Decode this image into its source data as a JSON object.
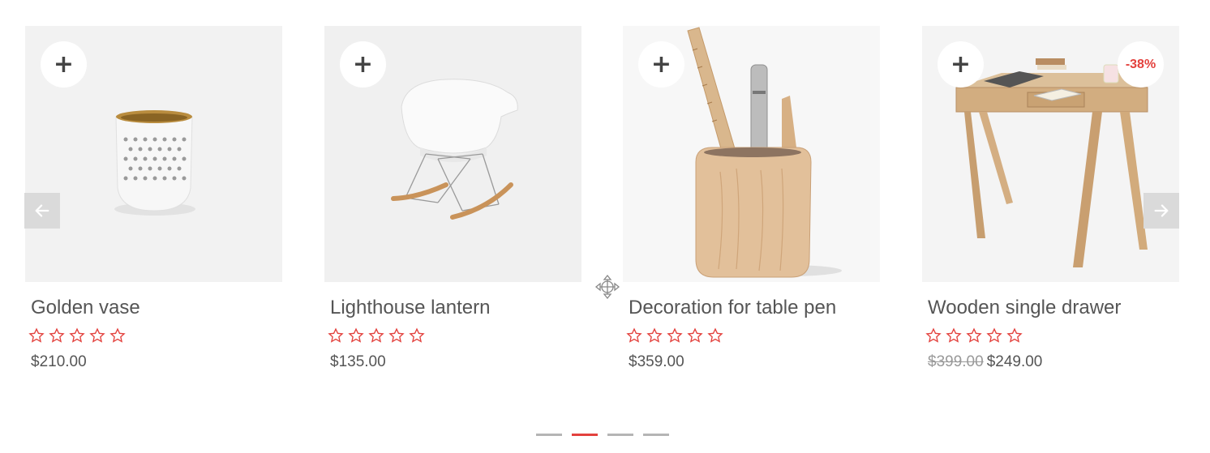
{
  "accent_color": "#e3413d",
  "products": [
    {
      "title": "Golden vase",
      "price": "$210.00",
      "old_price": "",
      "badge": "",
      "rating_stars": 5,
      "add_icon": "+"
    },
    {
      "title": "Lighthouse lantern",
      "price": "$135.00",
      "old_price": "",
      "badge": "",
      "rating_stars": 5,
      "add_icon": "+"
    },
    {
      "title": "Decoration for table pen",
      "price": "$359.00",
      "old_price": "",
      "badge": "",
      "rating_stars": 5,
      "add_icon": "+"
    },
    {
      "title": "Wooden single drawer",
      "price": "$249.00",
      "old_price": "$399.00",
      "badge": "-38%",
      "rating_stars": 5,
      "add_icon": "+"
    }
  ],
  "carousel": {
    "prev_icon": "arrow-left-icon",
    "next_icon": "arrow-right-icon",
    "page_count": 4,
    "active_page": 2
  }
}
